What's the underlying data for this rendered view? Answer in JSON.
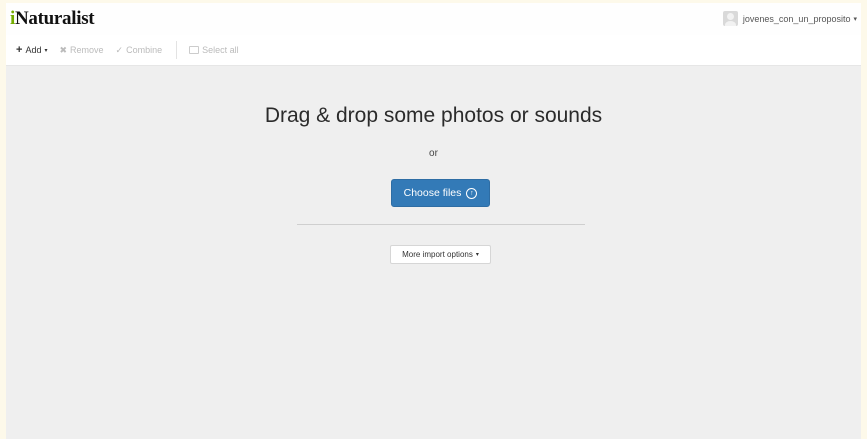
{
  "header": {
    "logo_prefix": "i",
    "logo_rest": "Naturalist",
    "user_name": "jovenes_con_un_proposito",
    "user_caret": "▾"
  },
  "toolbar": {
    "add_label": "Add",
    "add_caret": "▾",
    "remove_label": "Remove",
    "combine_label": "Combine",
    "select_all_label": "Select all"
  },
  "main": {
    "headline": "Drag & drop some photos or sounds",
    "or_text": "or",
    "choose_files_label": "Choose files",
    "more_import_label": "More import options",
    "more_import_caret": "▾"
  },
  "colors": {
    "brand_green": "#74ac00",
    "primary_blue": "#337ab7",
    "background": "#efefef"
  },
  "icons": {
    "add": "plus-icon",
    "remove": "x-icon",
    "combine": "check-icon",
    "select_all": "checkbox-icon",
    "choose_files": "upload-icon",
    "dropdown": "caret-down-icon",
    "user": "avatar"
  }
}
